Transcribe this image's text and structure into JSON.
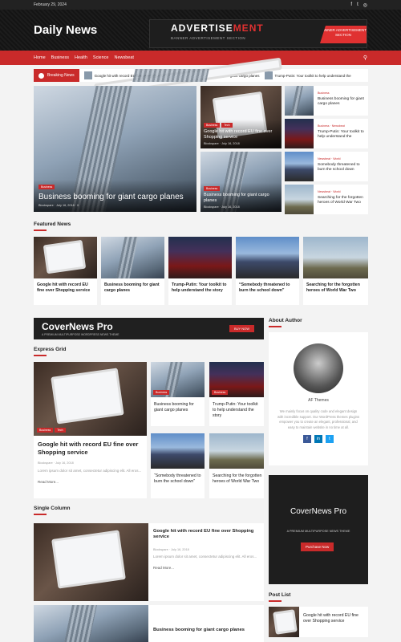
{
  "topbar": {
    "date": "February 29, 2024"
  },
  "site": {
    "title": "Daily News"
  },
  "ad": {
    "main_a": "ADVERTISE",
    "main_b": "MENT",
    "sub": "BANNER ADVERTISEMENT SECTION",
    "badge": "BANNER ADVERTISEMENT SECTION"
  },
  "nav": {
    "items": [
      "Home",
      "Business",
      "Health",
      "Science",
      "Newsbeat"
    ]
  },
  "ticker": {
    "label": "Breaking News",
    "items": [
      "Google hit with record EU fine over Shopping service",
      "Business booming for giant cargo planes",
      "Trump-Putin: Your toolkit to help understand the"
    ]
  },
  "meta": {
    "author": "Blockspare",
    "date": "July 16, 2018",
    "count": "0"
  },
  "cats": {
    "business": "Business",
    "tech": "Tech",
    "newsbeat": "Newsbeat",
    "world": "World"
  },
  "articles": {
    "google": "Google hit with record EU fine over Shopping service",
    "cargo": "Business booming for giant cargo planes",
    "trump": "Trump-Putin: Your toolkit to help understand the story",
    "trump_short": "Trump-Putin: Your toolkit to help understand the",
    "school": "“Somebody threatened to burn the school down”",
    "school_short": "Somebody threatened to burn the school down",
    "heroes": "Searching for the forgotten heroes of World War Two"
  },
  "sections": {
    "featured": "Featured News",
    "express": "Express Grid",
    "single": "Single Column",
    "about": "About Author",
    "postlist": "Post List"
  },
  "banner": {
    "title": "CoverNews Pro",
    "sub": "A PREMIUM MULTIPURPOSE WORDPRESS NEWS THEME",
    "cta": "BUY NOW"
  },
  "about": {
    "name": "AF Themes",
    "desc": "We mainly focus on quality code and elegant design with incredible support. Our WordPress themes plugins empower you to create an elegant, professional, and easy to maintain website in no time at all."
  },
  "promo": {
    "title": "CoverNews Pro",
    "sub": "A PREMIUM MULTIPURPOSE NEWS THEME",
    "cta": "Purchase Now"
  },
  "excerpt": "Lorem ipsum dolor sit amet, consectetur adipiscing elit. All eros...",
  "read_more": "Read More...",
  "colors": {
    "accent": "#c92a2a",
    "dark": "#161616"
  }
}
